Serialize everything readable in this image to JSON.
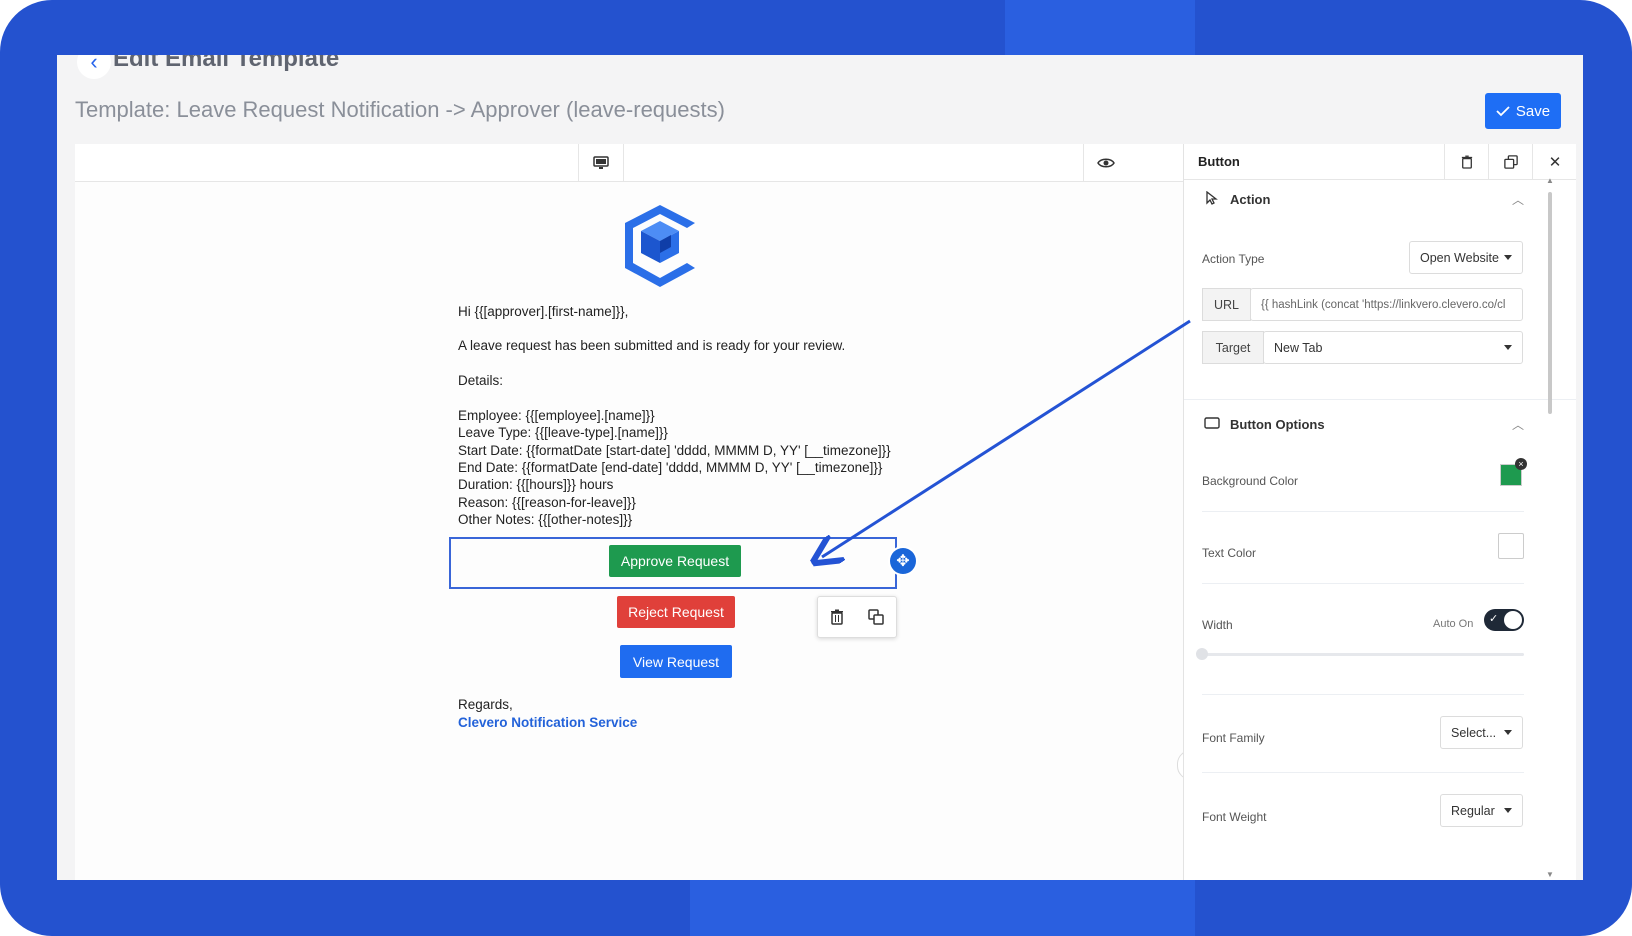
{
  "header": {
    "back_icon": "chevron-left-icon",
    "title": "Edit Email Template",
    "subtitle": "Template: Leave Request Notification -> Approver (leave-requests)",
    "save_label": "Save"
  },
  "canvas_toolbar": {
    "device_icon": "desktop-icon",
    "preview_icon": "eye-icon"
  },
  "email": {
    "greeting": "Hi {{[approver].[first-name]}},",
    "intro": "A leave request has been submitted and is ready for your review.",
    "details_label": "Details:",
    "details": [
      "Employee: {{[employee].[name]}}",
      "Leave Type: {{[leave-type].[name]}}",
      "Start Date: {{formatDate [start-date] 'dddd, MMMM D, YY' [__timezone]}}",
      "End Date: {{formatDate [end-date] 'dddd, MMMM D, YY' [__timezone]}}",
      "Duration: {{[hours]}} hours",
      "Reason: {{[reason-for-leave]}}",
      "Other Notes: {{[other-notes]}}"
    ],
    "buttons": {
      "approve": {
        "label": "Approve Request",
        "color": "#1e9a4f"
      },
      "reject": {
        "label": "Reject Request",
        "color": "#e0403a"
      },
      "view": {
        "label": "View Request",
        "color": "#1f6cf0"
      }
    },
    "regards": "Regards,",
    "signature": "Clevero Notification Service"
  },
  "panel": {
    "title": "Button",
    "action_section": {
      "title": "Action",
      "action_type_label": "Action Type",
      "action_type_value": "Open Website",
      "url_label": "URL",
      "url_value": "{{ hashLink (concat 'https://linkvero.clevero.co/cl",
      "target_label": "Target",
      "target_value": "New Tab"
    },
    "options_section": {
      "title": "Button Options",
      "background_color_label": "Background Color",
      "background_color": "#1e9a4f",
      "text_color_label": "Text Color",
      "text_color": "#ffffff",
      "width_label": "Width",
      "auto_label": "Auto On",
      "auto_on": true,
      "font_family_label": "Font Family",
      "font_family_value": "Select...",
      "font_weight_label": "Font Weight",
      "font_weight_value": "Regular"
    }
  },
  "colors": {
    "frame": "#2452cf",
    "accent": "#1e6ef5",
    "selection": "#3966d8"
  }
}
